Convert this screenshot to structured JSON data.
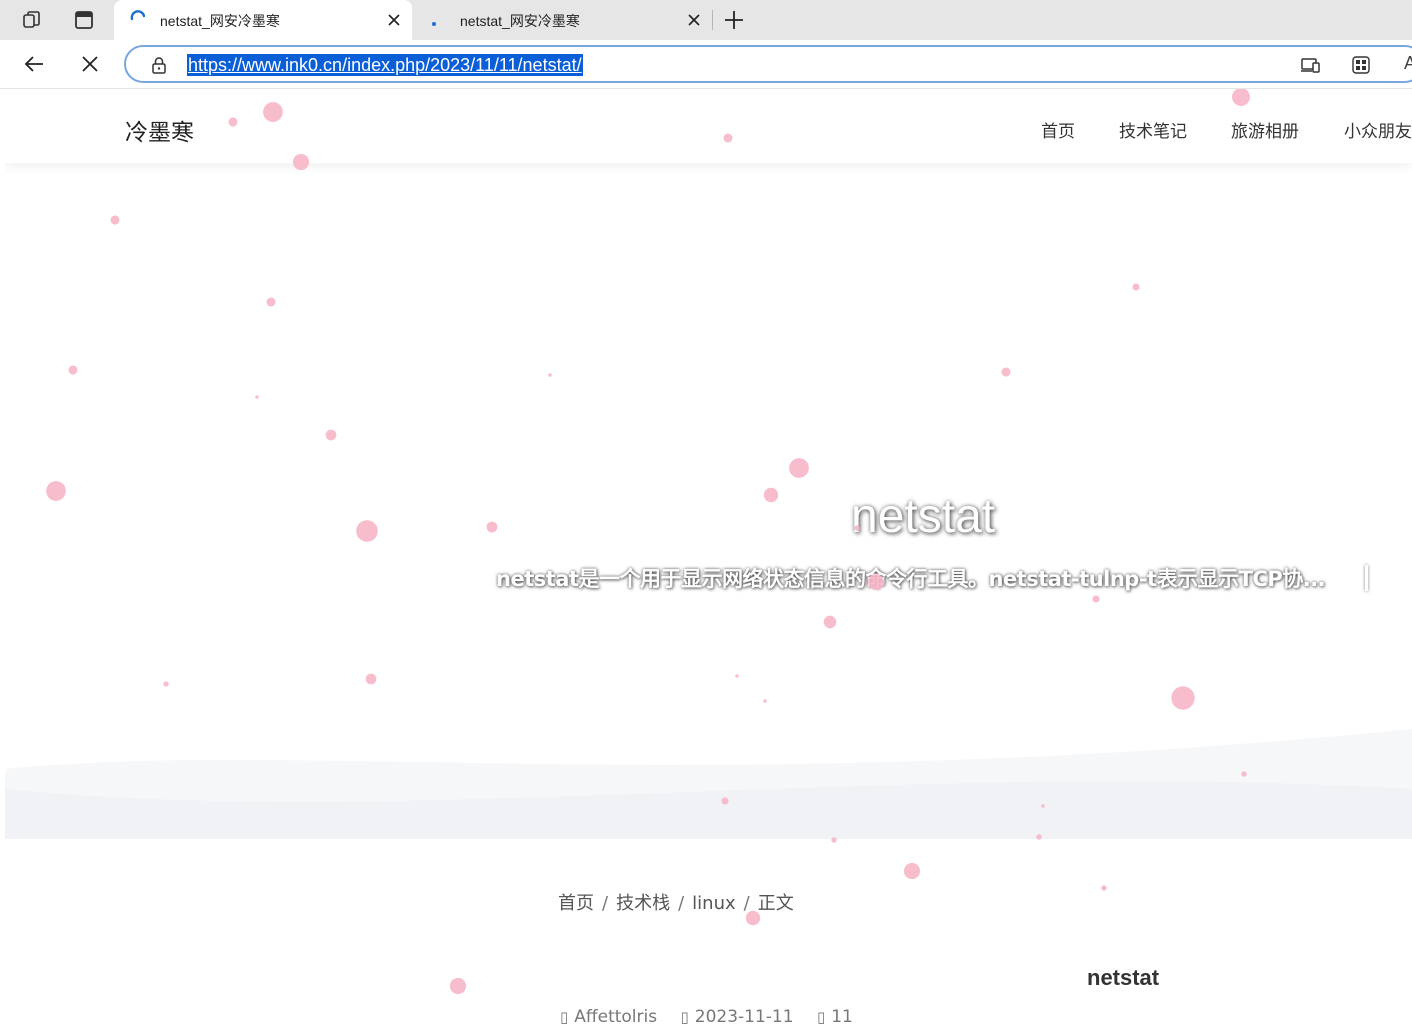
{
  "browser": {
    "tabs": [
      {
        "title": "netstat_网安冷墨寒",
        "active": true,
        "loading": true
      },
      {
        "title": "netstat_网安冷墨寒",
        "active": false,
        "loading": true
      }
    ],
    "url": "https://www.ink0.cn/index.php/2023/11/11/netstat/",
    "omnibox_more": "A"
  },
  "site": {
    "logo": "冷墨寒",
    "nav": [
      "首页",
      "技术笔记",
      "旅游相册",
      "小众朋友"
    ]
  },
  "hero": {
    "title": "netstat",
    "description": "netstat是一个用于显示网络状态信息的命令行工具。netstat-tulnp-t表示显示TCP协..."
  },
  "breadcrumb": [
    "首页",
    "技术栈",
    "linux",
    "正文"
  ],
  "post": {
    "title": "netstat",
    "author": "Affettolris",
    "date": "2023-11-11",
    "count": "11"
  },
  "colors": {
    "accent": "#0a5ed8",
    "petal": "#f7b6c8"
  }
}
